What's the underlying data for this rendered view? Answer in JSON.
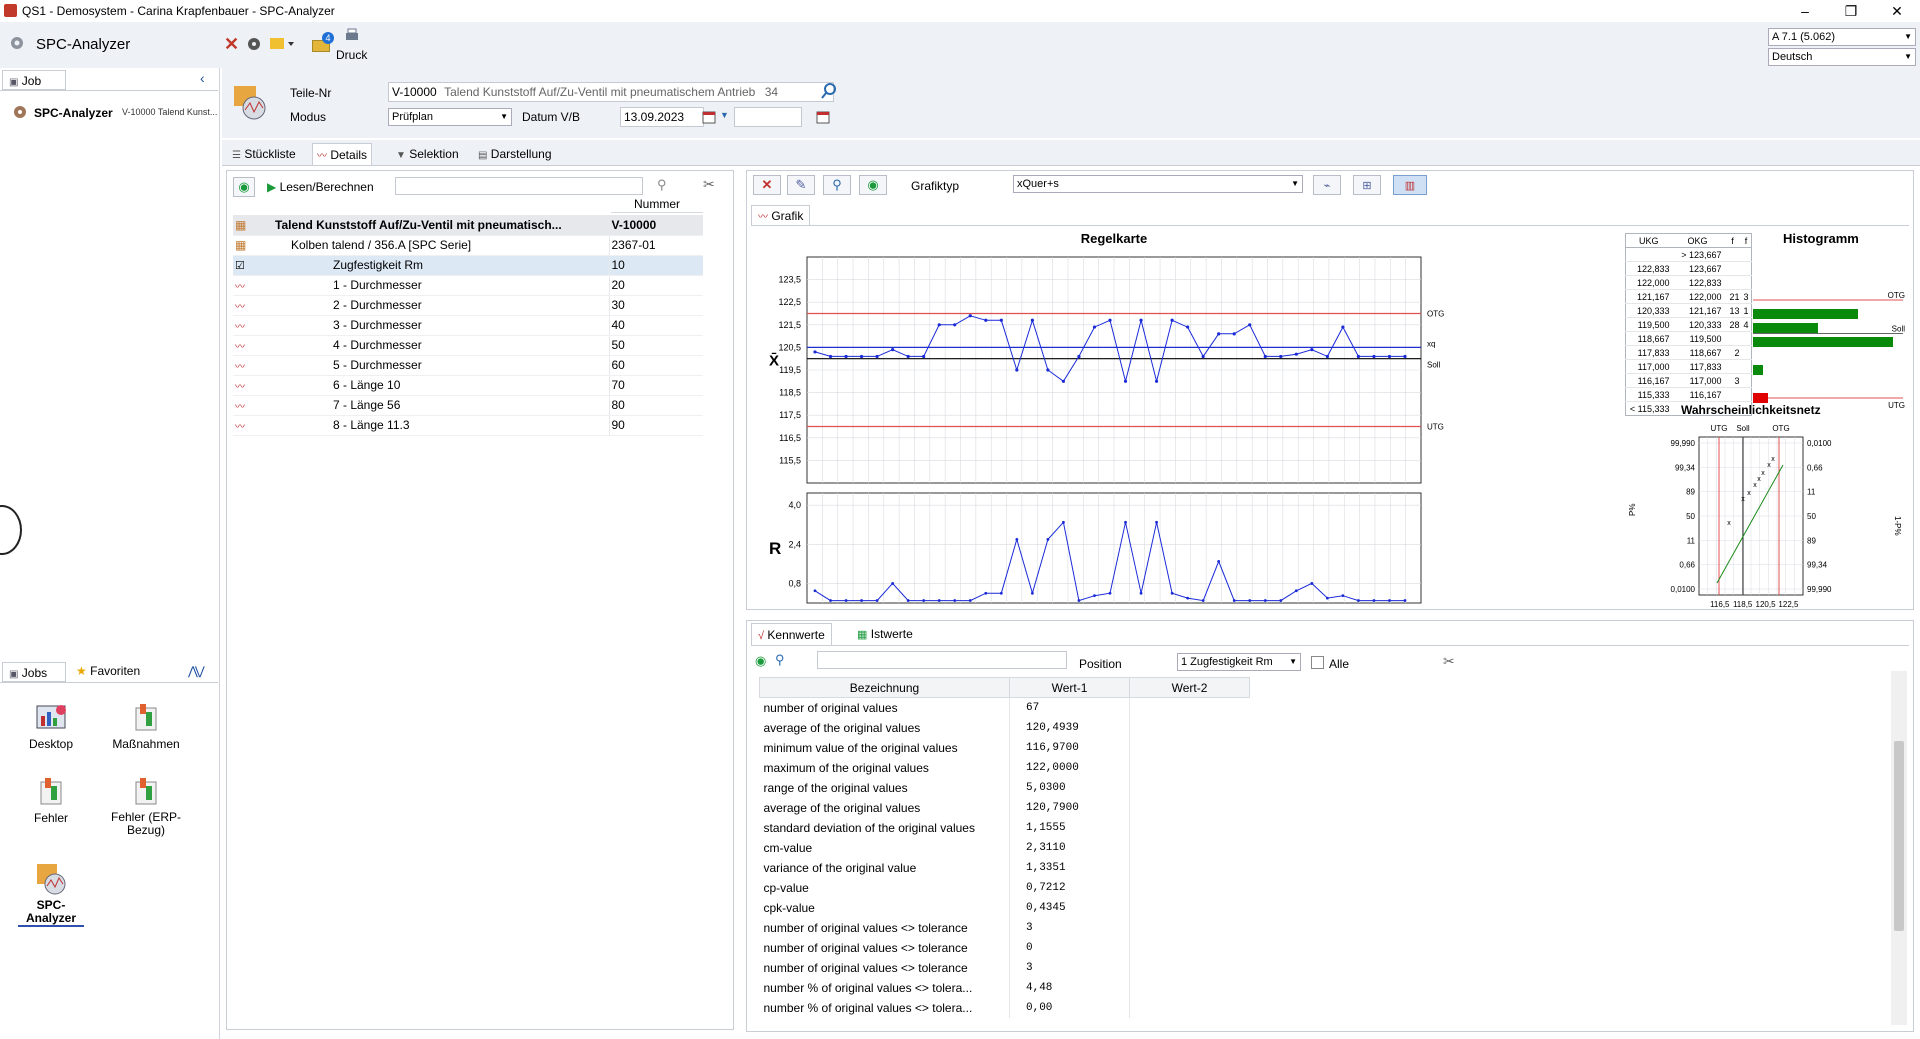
{
  "window": {
    "title": "QS1 - Demosystem - Carina Krapfenbauer - SPC-Analyzer",
    "minimize": "–",
    "restore": "❐",
    "close": "✕"
  },
  "appbar": {
    "app_name": "SPC-Analyzer",
    "print_label": "Druck",
    "print_badge": "4",
    "version_select": "A 7.1 (5.062)",
    "language_select": "Deutsch"
  },
  "left": {
    "job_tab": "Job",
    "job_entry_title": "SPC-Analyzer",
    "job_entry_sub": "V-10000 Talend Kunst...",
    "jobs_tab": "Jobs",
    "favorites_tab": "Favoriten",
    "tiles": [
      {
        "label": "Desktop"
      },
      {
        "label": "Maßnahmen"
      },
      {
        "label": "Fehler"
      },
      {
        "label": "Fehler (ERP-Bezug)"
      },
      {
        "label": "SPC-Analyzer"
      }
    ]
  },
  "form": {
    "teile_label": "Teile-Nr",
    "teile_nr": "V-10000",
    "teile_desc": "Talend Kunststoff Auf/Zu-Ventil mit pneumatischem Antrieb",
    "teile_count": "34",
    "modus_label": "Modus",
    "modus_value": "Prüfplan",
    "datum_label": "Datum V/B",
    "datum_von": "13.09.2023",
    "datum_bis": ""
  },
  "tabs": [
    {
      "label": "Stückliste"
    },
    {
      "label": "Details"
    },
    {
      "label": "Selektion"
    },
    {
      "label": "Darstellung"
    }
  ],
  "tree": {
    "read_btn": "Lesen/Berechnen",
    "search_value": "",
    "col_nummer": "Nummer",
    "rows": [
      {
        "name": "Talend Kunststoff Auf/Zu-Ventil mit pneumatisch...",
        "nr": "V-10000"
      },
      {
        "name": "Kolben talend / 356.A   [SPC Serie]",
        "nr": "2367-01"
      },
      {
        "name": "Zugfestigkeit Rm",
        "nr": "10"
      },
      {
        "name": "1 - Durchmesser",
        "nr": "20"
      },
      {
        "name": "2 - Durchmesser",
        "nr": "30"
      },
      {
        "name": "3 - Durchmesser",
        "nr": "40"
      },
      {
        "name": "4 - Durchmesser",
        "nr": "50"
      },
      {
        "name": "5 - Durchmesser",
        "nr": "60"
      },
      {
        "name": "6 - Länge 10",
        "nr": "70"
      },
      {
        "name": "7 - Länge 56",
        "nr": "80"
      },
      {
        "name": "8 - Länge 11.3",
        "nr": "90"
      }
    ]
  },
  "chart_toolbar": {
    "grafiktyp_label": "Grafiktyp",
    "grafiktyp_value": "xQuer+s",
    "grafik_tab": "Grafik"
  },
  "chart_data": [
    {
      "type": "line",
      "title": "Regelkarte",
      "ylabel": "X̄",
      "ylim": [
        114.5,
        124.5
      ],
      "yticks": [
        "123,5",
        "122,5",
        "121,5",
        "120,5",
        "119,5",
        "118,5",
        "117,5",
        "116,5",
        "115,5"
      ],
      "limits": {
        "OTG": 122.0,
        "xq": 120.5,
        "Soll": 120.0,
        "UTG": 117.0
      },
      "limit_labels": [
        "OTG",
        "xq",
        "Soll",
        "UTG"
      ],
      "limit_colors": {
        "OTG": "#e05050",
        "xq": "#2030d0",
        "Soll": "#000000",
        "UTG": "#e05050"
      },
      "x": [
        1,
        2,
        3,
        4,
        5,
        6,
        7,
        8,
        9,
        10,
        11,
        12,
        13,
        14,
        15,
        16,
        17,
        18,
        19,
        20,
        21,
        22,
        23,
        24,
        25,
        26,
        27,
        28,
        29,
        30,
        31,
        32,
        33,
        34,
        35,
        36,
        37,
        38,
        39
      ],
      "values": [
        120.3,
        120.1,
        120.1,
        120.1,
        120.1,
        120.4,
        120.1,
        120.1,
        121.5,
        121.5,
        121.9,
        121.7,
        121.7,
        119.5,
        121.7,
        119.5,
        119.0,
        120.1,
        121.4,
        121.7,
        119.0,
        121.7,
        119.0,
        121.7,
        121.4,
        120.1,
        121.1,
        121.1,
        121.5,
        120.1,
        120.1,
        120.2,
        120.4,
        120.1,
        121.4,
        120.1,
        120.1,
        120.1,
        120.1
      ],
      "series_color": "#1a2ad8"
    },
    {
      "type": "line",
      "title": "",
      "ylabel": "R",
      "ylim": [
        0,
        4.5
      ],
      "yticks": [
        "4,0",
        "2,4",
        "0,8"
      ],
      "x": [
        1,
        2,
        3,
        4,
        5,
        6,
        7,
        8,
        9,
        10,
        11,
        12,
        13,
        14,
        15,
        16,
        17,
        18,
        19,
        20,
        21,
        22,
        23,
        24,
        25,
        26,
        27,
        28,
        29,
        30,
        31,
        32,
        33,
        34,
        35,
        36,
        37,
        38,
        39
      ],
      "values": [
        0.5,
        0.1,
        0.1,
        0.1,
        0.1,
        0.8,
        0.1,
        0.1,
        0.1,
        0.1,
        0.1,
        0.4,
        0.4,
        2.6,
        0.4,
        2.6,
        3.3,
        0.1,
        0.3,
        0.4,
        3.3,
        0.4,
        3.3,
        0.4,
        0.2,
        0.1,
        1.7,
        0.1,
        0.1,
        0.1,
        0.1,
        0.5,
        0.8,
        0.2,
        0.3,
        0.1,
        0.1,
        0.1,
        0.1
      ],
      "series_color": "#1a2ad8"
    },
    {
      "type": "bar",
      "title": "Histogramm",
      "table_headers": [
        "UKG",
        "OKG",
        "f",
        "f"
      ],
      "table_rows": [
        [
          "",
          "> 123,667",
          "",
          ""
        ],
        [
          "122,833",
          "123,667",
          "",
          ""
        ],
        [
          "122,000",
          "122,833",
          "",
          ""
        ],
        [
          "121,167",
          "122,000",
          "21",
          "3"
        ],
        [
          "120,333",
          "121,167",
          "13",
          "1"
        ],
        [
          "119,500",
          "120,333",
          "28",
          "4"
        ],
        [
          "118,667",
          "119,500",
          "",
          ""
        ],
        [
          "117,833",
          "118,667",
          "2",
          ""
        ],
        [
          "117,000",
          "117,833",
          "",
          ""
        ],
        [
          "116,167",
          "117,000",
          "3",
          ""
        ],
        [
          "115,333",
          "116,167",
          "",
          ""
        ],
        [
          "< 115,333",
          "",
          "",
          ""
        ]
      ],
      "categories": [
        "121,167–122,000",
        "120,333–121,167",
        "119,500–120,333",
        "117,833–118,667",
        "116,167–117,000"
      ],
      "values": [
        21,
        13,
        28,
        2,
        3
      ],
      "bar_colors": [
        "#0a8a0a",
        "#0a8a0a",
        "#0a8a0a",
        "#0a8a0a",
        "#e00000"
      ],
      "labels": [
        "OTG",
        "Soll",
        "UTG"
      ]
    },
    {
      "type": "scatter",
      "title": "Wahrscheinlichkeitsnetz",
      "ylabel_left": "P%",
      "ylabel_right": "1-P%",
      "top_labels": [
        "UTG",
        "Soll",
        "OTG"
      ],
      "left_ticks": [
        "99,990",
        "99,34",
        "89",
        "50",
        "11",
        "0,66",
        "0,0100"
      ],
      "right_ticks": [
        "0,0100",
        "0,66",
        "11",
        "50",
        "89",
        "99,34",
        "99,990"
      ],
      "xticks": [
        "116,5",
        "118,5",
        "120,5",
        "122,5"
      ],
      "xlim": [
        115.5,
        123.5
      ]
    }
  ],
  "kenn": {
    "tab_kennwerte": "Kennwerte",
    "tab_istwerte": "Istwerte",
    "position_label": "Position",
    "position_value": "1 Zugfestigkeit Rm",
    "alle_label": "Alle",
    "headers": [
      "Bezeichnung",
      "Wert-1",
      "Wert-2"
    ],
    "rows": [
      {
        "name": "number of original values",
        "w1": "67"
      },
      {
        "name": "average of the original values",
        "w1": "120,4939"
      },
      {
        "name": "minimum value of the original values",
        "w1": "116,9700"
      },
      {
        "name": "maximum of the original values",
        "w1": "122,0000"
      },
      {
        "name": "range of the original values",
        "w1": "5,0300"
      },
      {
        "name": "average of the original values",
        "w1": "120,7900"
      },
      {
        "name": "standard deviation of the original values",
        "w1": "1,1555"
      },
      {
        "name": "cm-value",
        "w1": "2,3110"
      },
      {
        "name": "variance of the original value",
        "w1": "1,3351"
      },
      {
        "name": "cp-value",
        "w1": "0,7212"
      },
      {
        "name": "cpk-value",
        "w1": "0,4345"
      },
      {
        "name": "number of original values <> tolerance",
        "w1": "3"
      },
      {
        "name": "number of original values <> tolerance",
        "w1": "0"
      },
      {
        "name": "number of original values <> tolerance",
        "w1": "3"
      },
      {
        "name": "number % of original values <> tolera...",
        "w1": "4,48"
      },
      {
        "name": "number % of original values <> tolera...",
        "w1": "0,00"
      }
    ]
  }
}
